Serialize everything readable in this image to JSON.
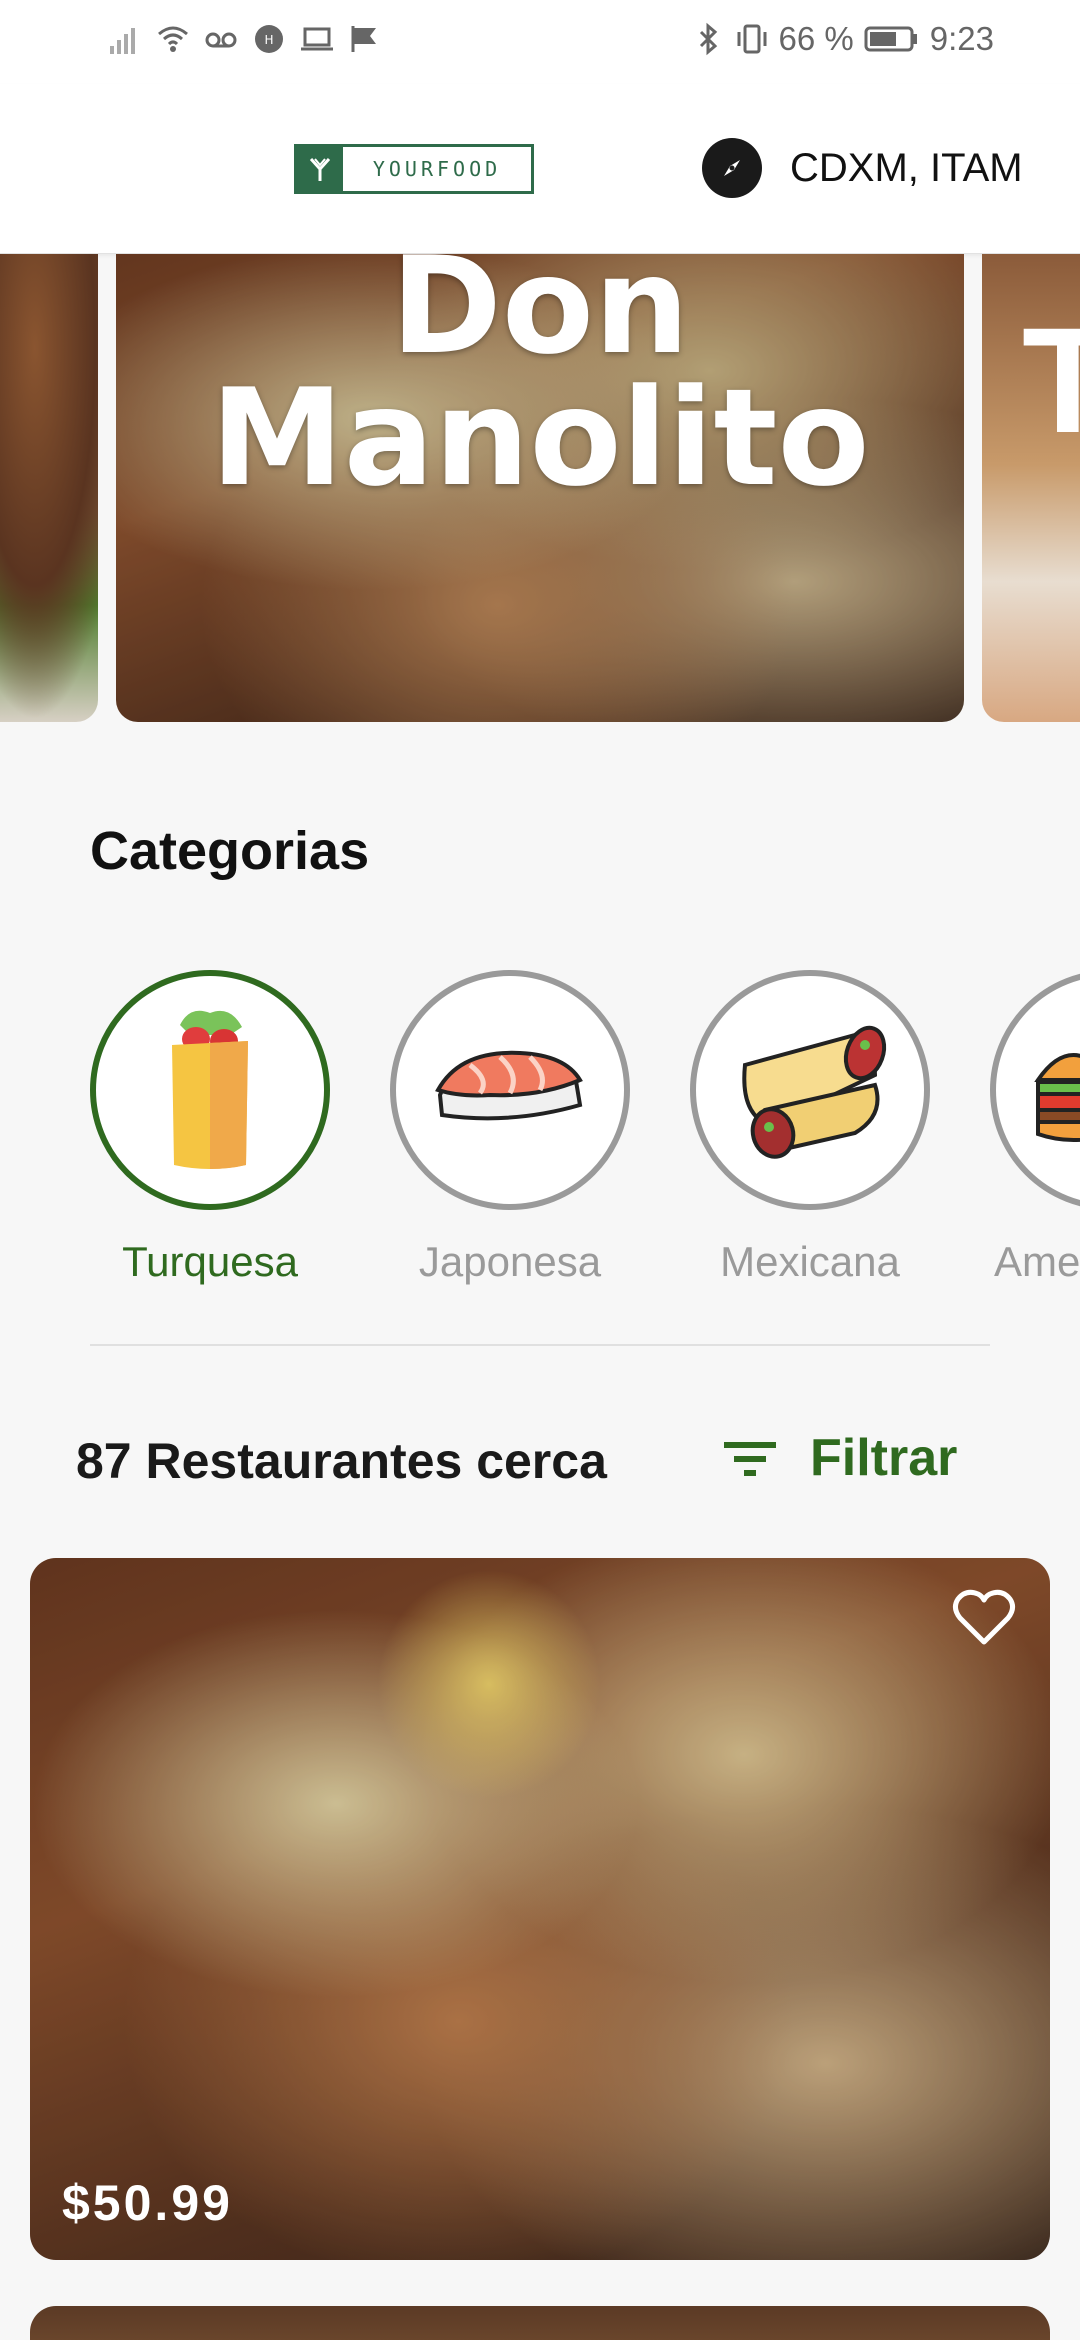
{
  "status_bar": {
    "battery": "66 %",
    "time": "9:23",
    "icons": [
      "signal-icon",
      "wifi-icon",
      "voicemail-icon",
      "hd-icon",
      "laptop-icon",
      "check-flag-icon",
      "bluetooth-icon",
      "vibrate-icon",
      "battery-icon"
    ]
  },
  "header": {
    "logo_text": "YOURFOOD",
    "location": "CDXM, ITAM",
    "location_icon": "compass-icon"
  },
  "carousel": {
    "main_title": "Don Manolito",
    "right_letter": "T"
  },
  "categories": {
    "title": "Categorias",
    "items": [
      {
        "label": "Turquesa",
        "icon": "burrito-wrap-icon",
        "selected": true
      },
      {
        "label": "Japonesa",
        "icon": "sushi-icon",
        "selected": false
      },
      {
        "label": "Mexicana",
        "icon": "enchilada-icon",
        "selected": false
      },
      {
        "label": "Ame",
        "icon": "burger-icon",
        "selected": false
      }
    ]
  },
  "restaurants": {
    "count_label": "87 Restaurantes cerca",
    "filter_label": "Filtrar",
    "filter_icon": "filter-lines-icon",
    "card": {
      "price": "$50.99",
      "favorite_icon": "heart-outline-icon"
    }
  },
  "colors": {
    "accent_green": "#2f6a1f",
    "logo_green": "#2e6b4a",
    "inactive_gray": "#9a9a9a"
  }
}
